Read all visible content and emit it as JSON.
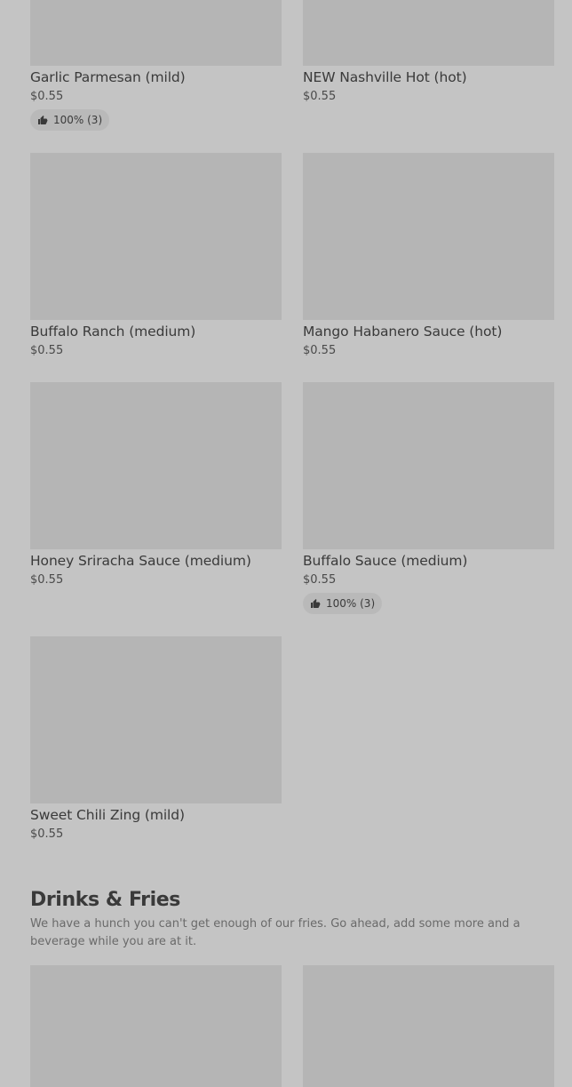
{
  "items": [
    {
      "name": "Garlic Parmesan (mild)",
      "price": "$0.55",
      "rating": "100% (3)"
    },
    {
      "name": "NEW Nashville Hot (hot)",
      "price": "$0.55"
    },
    {
      "name": "Buffalo Ranch (medium)",
      "price": "$0.55"
    },
    {
      "name": "Mango Habanero Sauce (hot)",
      "price": "$0.55"
    },
    {
      "name": "Honey Sriracha Sauce (medium)",
      "price": "$0.55"
    },
    {
      "name": "Buffalo Sauce (medium)",
      "price": "$0.55",
      "rating": "100% (3)"
    },
    {
      "name": "Sweet Chili Zing (mild)",
      "price": "$0.55"
    }
  ],
  "section": {
    "title": "Drinks & Fries",
    "description": "We have a hunch you can't get enough of our fries. Go ahead, add some more and a beverage while you are at it."
  },
  "colors": {
    "background": "#c4c4c4",
    "image_placeholder": "#b5b5b5",
    "badge_background": "#b9b9b9",
    "text": "#3a3a3a"
  },
  "icons": {
    "rating": "thumbs-up-icon"
  }
}
